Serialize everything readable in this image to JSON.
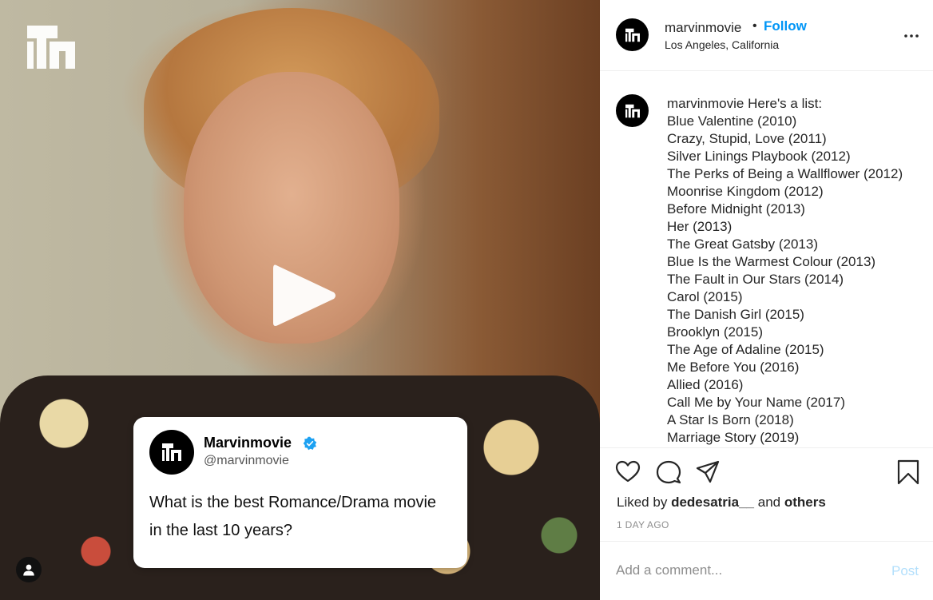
{
  "header": {
    "username": "marvinmovie",
    "separator": "•",
    "follow_label": "Follow",
    "location": "Los Angeles, California"
  },
  "tweet": {
    "name": "Marvinmovie",
    "handle": "@marvinmovie",
    "text": "What is the best Romance/Drama movie in the last 10 years?"
  },
  "caption": {
    "username": "marvinmovie",
    "intro": "Here's a list:",
    "movies": [
      "Blue Valentine (2010)",
      "Crazy, Stupid, Love (2011)",
      "Silver Linings Playbook (2012)",
      "The Perks of Being a Wallflower (2012)",
      "Moonrise Kingdom (2012)",
      "Before Midnight (2013)",
      "Her (2013)",
      "The Great Gatsby (2013)",
      "Blue Is the Warmest Colour (2013)",
      "The Fault in Our Stars (2014)",
      "Carol (2015)",
      "The Danish Girl (2015)",
      "Brooklyn (2015)",
      "The Age of Adaline (2015)",
      "Me Before You (2016)",
      "Allied (2016)",
      "Call Me by Your Name (2017)",
      "A Star Is Born (2018)",
      "Marriage Story (2019)"
    ]
  },
  "likes": {
    "prefix": "Liked by",
    "user": "dedesatria__",
    "connector": "and",
    "others": "others"
  },
  "timestamp": "1 DAY AGO",
  "comment": {
    "placeholder": "Add a comment...",
    "post_label": "Post"
  },
  "colors": {
    "accent": "#0095f6",
    "post_disabled": "#b2dffc",
    "text": "#262626",
    "muted": "#8e8e8e"
  },
  "icons": [
    "brand-logo-icon",
    "play-icon",
    "verified-badge-icon",
    "user-tag-icon",
    "more-options-icon",
    "heart-icon",
    "comment-icon",
    "share-icon",
    "bookmark-icon"
  ]
}
